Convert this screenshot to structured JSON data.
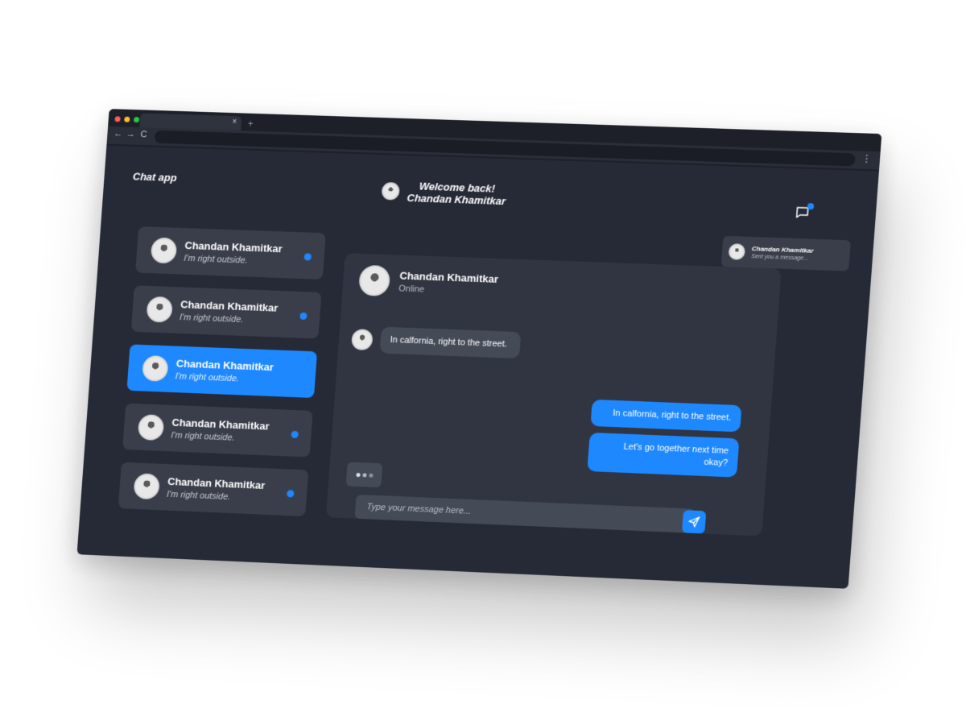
{
  "app": {
    "title": "Chat app",
    "welcome_line1": "Welcome back!",
    "welcome_line2": "Chandan Khamitkar"
  },
  "browser": {
    "tab_close": "×",
    "new_tab": "+",
    "back": "←",
    "forward": "→",
    "reload": "C",
    "menu": "⋮"
  },
  "notification": {
    "name": "Chandan Khamitkar",
    "text": "Sent you a message..."
  },
  "contacts": [
    {
      "name": "Chandan Khamitkar",
      "message": "I'm right outside.",
      "unread": true,
      "active": false
    },
    {
      "name": "Chandan Khamitkar",
      "message": "I'm right outside.",
      "unread": true,
      "active": false
    },
    {
      "name": "Chandan Khamitkar",
      "message": "I'm right outside.",
      "unread": false,
      "active": true
    },
    {
      "name": "Chandan Khamitkar",
      "message": "I'm right outside.",
      "unread": true,
      "active": false
    },
    {
      "name": "Chandan Khamitkar",
      "message": "I'm right outside.",
      "unread": true,
      "active": false
    }
  ],
  "conversation": {
    "name": "Chandan Khamitkar",
    "status": "Online",
    "incoming": "In calfornia, right to the street.",
    "outgoing": [
      "In calfornia, right to the street.",
      "Let's go together next time okay?"
    ]
  },
  "composer": {
    "placeholder": "Type your message here..."
  },
  "colors": {
    "accent": "#1e88ff",
    "background": "#262a36",
    "panel": "#313541",
    "card": "#3a3e4a"
  },
  "icons": [
    "message-notification-icon",
    "send-icon",
    "avatar"
  ]
}
